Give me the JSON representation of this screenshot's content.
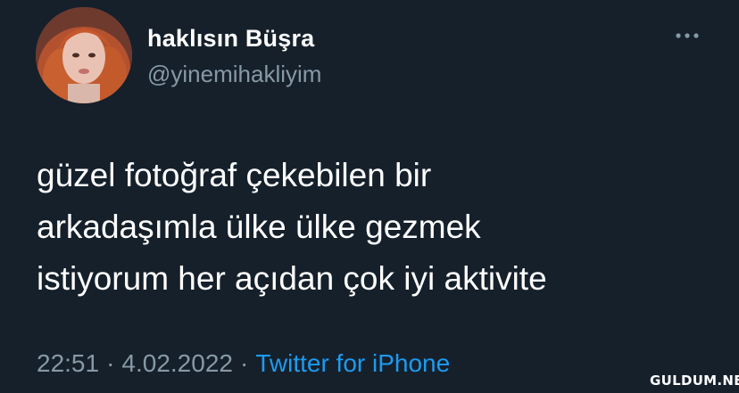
{
  "user": {
    "display_name": "haklısın Büşra",
    "handle": "@yinemihakliyim",
    "avatar_icon": "profile-photo"
  },
  "tweet": {
    "text": "güzel fotoğraf çekebilen bir\narkadaşımla ülke ülke gezmek\nistiyorum her açıdan çok iyi aktivite",
    "time": "22:51",
    "separator": "·",
    "date": "4.02.2022",
    "source": "Twitter for iPhone"
  },
  "menu": {
    "icon": "more-horizontal-icon"
  },
  "watermark": {
    "text": "GULDUM.NET"
  },
  "colors": {
    "background": "#15202b",
    "primary_text": "#ffffff",
    "secondary_text": "#8899a6",
    "accent": "#1d9bf0"
  }
}
